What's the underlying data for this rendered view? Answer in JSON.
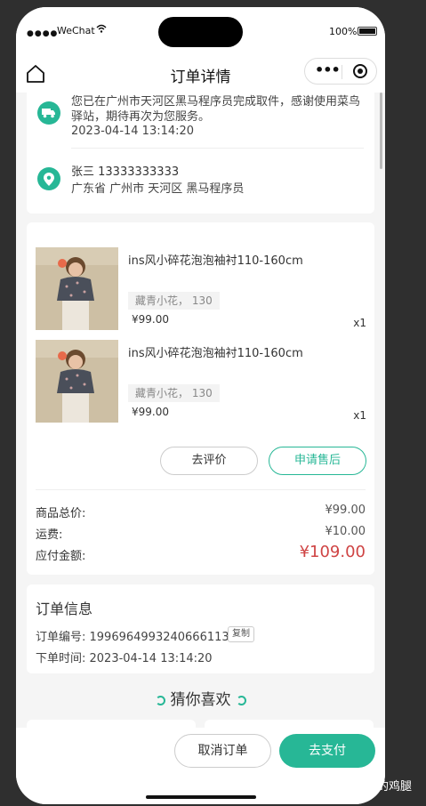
{
  "status_bar": {
    "signal": "●●●●",
    "carrier": "WeChat",
    "battery": "100%"
  },
  "nav": {
    "title": "订单详情"
  },
  "logistics": {
    "message": "您已在广州市天河区黑马程序员完成取件，感谢使用菜鸟驿站，期待再次为您服务。",
    "time": "2023-04-14 13:14:20"
  },
  "address": {
    "person": "张三 13333333333",
    "detail": "广东省 广州市 天河区 黑马程序员"
  },
  "goods": [
    {
      "name": "ins风小碎花泡泡袖衬110-160cm",
      "spec": "藏青小花， 130",
      "price": "¥99.00",
      "qty": "x1"
    },
    {
      "name": "ins风小碎花泡泡袖衬110-160cm",
      "spec": "藏青小花， 130",
      "price": "¥99.00",
      "qty": "x1"
    }
  ],
  "actions": {
    "review": "去评价",
    "aftersale": "申请售后"
  },
  "summary": {
    "total_label": "商品总价:",
    "total_value": "¥99.00",
    "freight_label": "运费:",
    "freight_value": "¥10.00",
    "pay_label": "应付金额:",
    "pay_value": "¥109.00"
  },
  "order_info": {
    "title": "订单信息",
    "number": "订单编号: 1996964993240666113",
    "copy": "复制",
    "time": "下单时间: 2023-04-14 13:14:20"
  },
  "guess": {
    "title": "猜你喜欢"
  },
  "bottom": {
    "cancel": "取消订单",
    "pay": "去支付"
  },
  "watermark": "掘金技术社区 @ 爱泡脚的鸡腿",
  "colors": {
    "accent": "#27b796",
    "price": "#cf4444"
  }
}
